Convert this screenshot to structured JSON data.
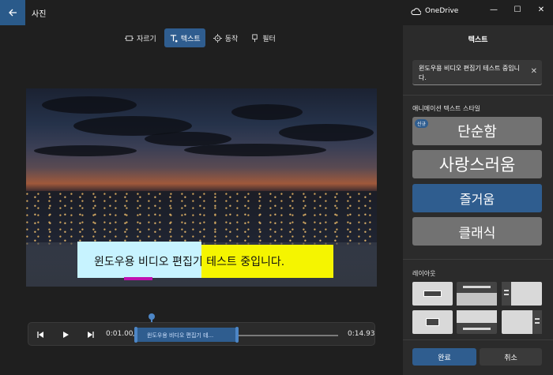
{
  "window": {
    "app_title": "사진",
    "onedrive_label": "OneDrive",
    "minimize_glyph": "—",
    "maximize_glyph": "☐",
    "close_glyph": "✕"
  },
  "toolbar": {
    "tools": [
      {
        "label": "자르기",
        "icon": "trim-icon"
      },
      {
        "label": "텍스트",
        "icon": "text-icon"
      },
      {
        "label": "동작",
        "icon": "motion-icon"
      },
      {
        "label": "필터",
        "icon": "filter-icon"
      }
    ],
    "active": "텍스트"
  },
  "video": {
    "caption": "윈도우용 비디오 편집기 테스트 중입니다."
  },
  "timeline": {
    "start_time": "0:01.00",
    "end_time": "0:14.93",
    "clip_label": "윈도우용 비디오 편집기 테..."
  },
  "panel": {
    "title": "텍스트",
    "text_value": "윈도우용 비디오 편집기 테스트 중입니다.",
    "clear_glyph": "✕",
    "styles_label": "애니메이션 텍스트 스타일",
    "new_badge": "신규",
    "styles": [
      "단순함",
      "사랑스러움",
      "즐거움",
      "클래식"
    ],
    "selected_style": "즐거움",
    "layout_label": "레이아웃",
    "done_label": "완료",
    "cancel_label": "취소"
  },
  "colors": {
    "accent": "#2f5d8f",
    "caption_bg_left": "#c7f3ff",
    "caption_bg_right": "#f5f500",
    "caption_underline": "#c010b0"
  }
}
